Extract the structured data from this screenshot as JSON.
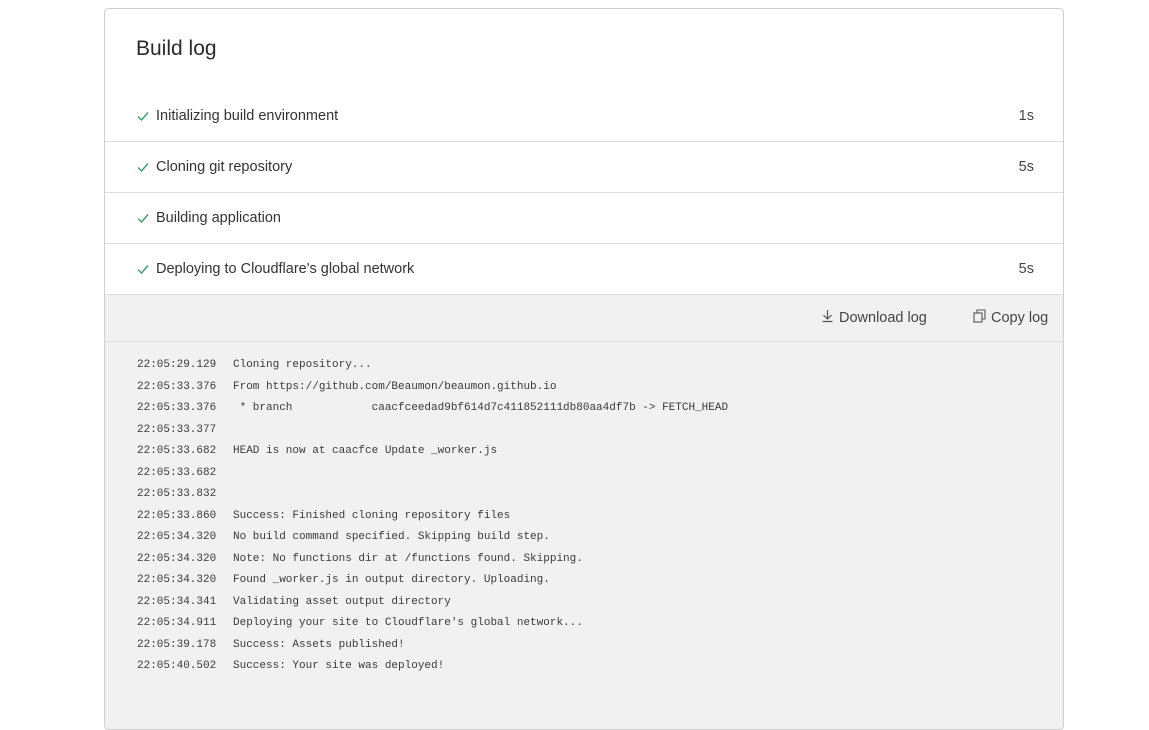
{
  "title": "Build log",
  "steps": [
    {
      "label": "Initializing build environment",
      "duration": "1s"
    },
    {
      "label": "Cloning git repository",
      "duration": "5s"
    },
    {
      "label": "Building application",
      "duration": ""
    },
    {
      "label": "Deploying to Cloudflare's global network",
      "duration": "5s"
    }
  ],
  "toolbar": {
    "download_label": "Download log",
    "copy_label": "Copy log"
  },
  "icons": {
    "step_status": "check-icon",
    "download": "download-icon",
    "copy": "copy-icon"
  },
  "colors": {
    "check": "#3b9a64",
    "panel_bg": "#f1f1f1",
    "border": "#cfcfcf"
  },
  "log": [
    {
      "time": "22:05:29.129",
      "text": "Cloning repository..."
    },
    {
      "time": "22:05:33.376",
      "text": "From https://github.com/Beaumon/beaumon.github.io"
    },
    {
      "time": "22:05:33.376",
      "text": " * branch            caacfceedad9bf614d7c411852111db80aa4df7b -> FETCH_HEAD"
    },
    {
      "time": "22:05:33.377",
      "text": ""
    },
    {
      "time": "22:05:33.682",
      "text": "HEAD is now at caacfce Update _worker.js"
    },
    {
      "time": "22:05:33.682",
      "text": ""
    },
    {
      "time": "22:05:33.832",
      "text": ""
    },
    {
      "time": "22:05:33.860",
      "text": "Success: Finished cloning repository files"
    },
    {
      "time": "22:05:34.320",
      "text": "No build command specified. Skipping build step."
    },
    {
      "time": "22:05:34.320",
      "text": "Note: No functions dir at /functions found. Skipping."
    },
    {
      "time": "22:05:34.320",
      "text": "Found _worker.js in output directory. Uploading."
    },
    {
      "time": "22:05:34.341",
      "text": "Validating asset output directory"
    },
    {
      "time": "22:05:34.911",
      "text": "Deploying your site to Cloudflare's global network..."
    },
    {
      "time": "22:05:39.178",
      "text": "Success: Assets published!"
    },
    {
      "time": "22:05:40.502",
      "text": "Success: Your site was deployed!"
    }
  ]
}
